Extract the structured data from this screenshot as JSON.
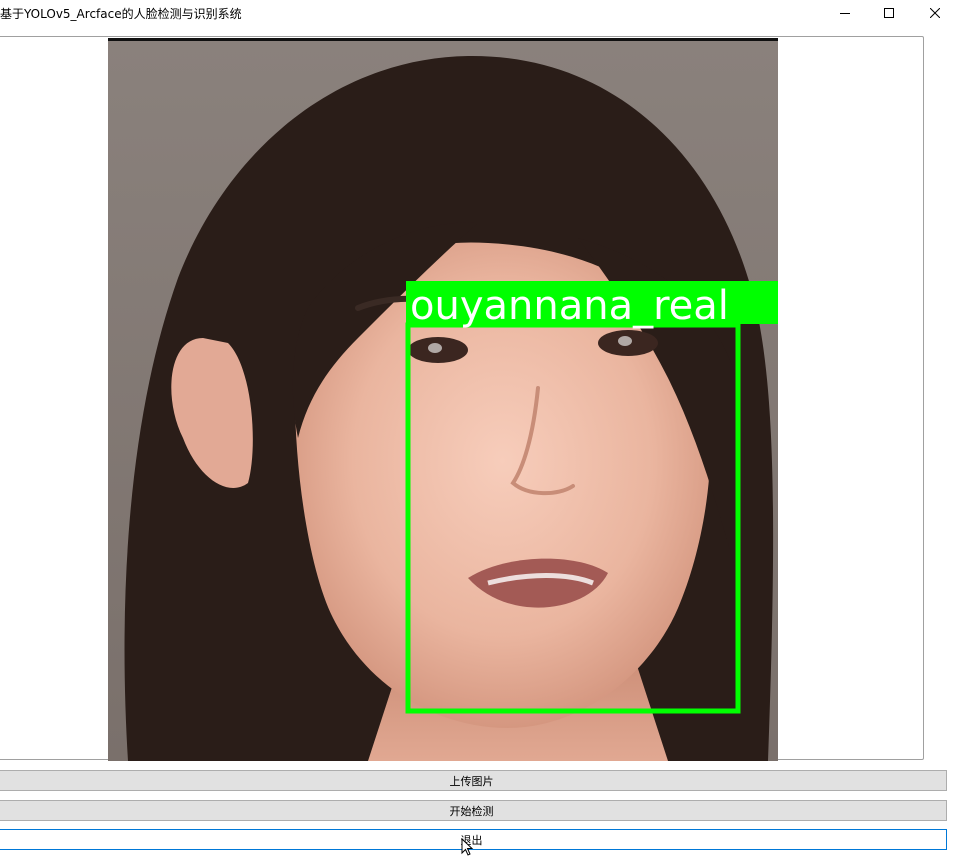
{
  "window": {
    "title": "基于YOLOv5_Arcface的人脸检测与识别系统",
    "controls": [
      "minimize-icon",
      "maximize-icon",
      "close-icon"
    ]
  },
  "viewer": {
    "detection_label": "ouyannana_real",
    "box_color": "#00ff00"
  },
  "buttons": {
    "upload": "上传图片",
    "detect": "开始检测",
    "exit": "退出"
  },
  "colors": {
    "button_face": "#e1e1e1",
    "focus_border": "#0078d7"
  }
}
